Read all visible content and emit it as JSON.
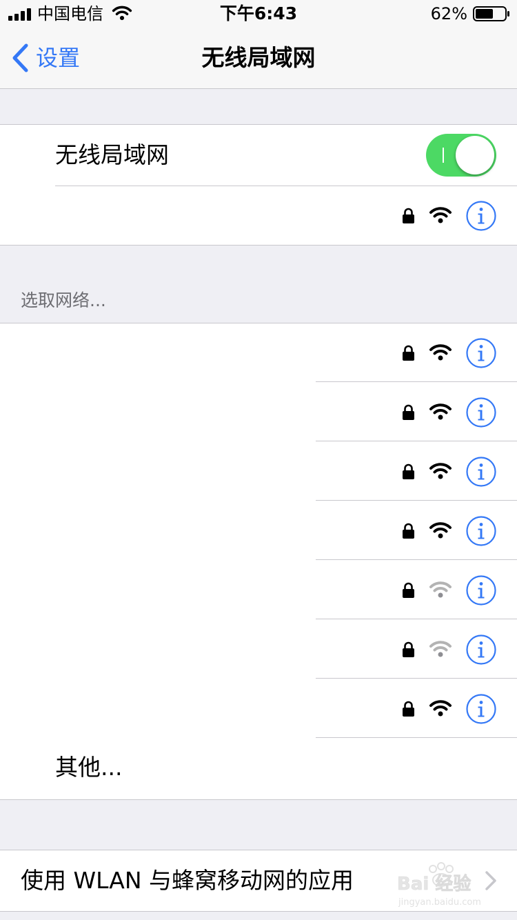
{
  "status_bar": {
    "carrier": "中国电信",
    "time": "下午6:43",
    "battery_percent": "62%",
    "battery_level": 0.62,
    "signal_bars": 4
  },
  "nav": {
    "back_label": "设置",
    "title": "无线局域网"
  },
  "wifi_section": {
    "toggle_label": "无线局域网",
    "toggle_on": true,
    "connected_network": {
      "secured": true,
      "signal": "full"
    }
  },
  "choose_network": {
    "header": "选取网络...",
    "networks": [
      {
        "secured": true,
        "signal": "full"
      },
      {
        "secured": true,
        "signal": "full"
      },
      {
        "secured": true,
        "signal": "full"
      },
      {
        "secured": true,
        "signal": "full"
      },
      {
        "secured": true,
        "signal": "weak"
      },
      {
        "secured": true,
        "signal": "weak"
      },
      {
        "secured": true,
        "signal": "full"
      }
    ],
    "other_label": "其他..."
  },
  "apps_row": {
    "label": "使用 WLAN 与蜂窝移动网的应用"
  },
  "watermark": {
    "brand": "Baidu经验",
    "url": "jingyan.baidu.com"
  },
  "colors": {
    "accent": "#3478f6",
    "toggle_on": "#4cd964",
    "background": "#efeff4",
    "separator": "#c8c7cc"
  },
  "icons": [
    "signal-bars-icon",
    "wifi-icon",
    "battery-icon",
    "chevron-left-icon",
    "lock-icon",
    "info-icon",
    "chevron-right-icon"
  ]
}
